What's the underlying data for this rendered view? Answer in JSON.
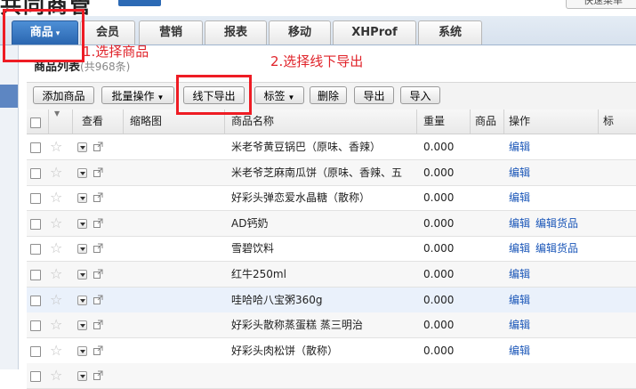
{
  "header": {
    "logo_text": "共同商管",
    "quick_menu": "快速菜单"
  },
  "nav": {
    "tabs": [
      {
        "label": "商品",
        "active": true
      },
      {
        "label": "会员"
      },
      {
        "label": "营销"
      },
      {
        "label": "报表"
      },
      {
        "label": "移动"
      },
      {
        "label": "XHProf"
      },
      {
        "label": "系统"
      }
    ],
    "active_caret": "▾"
  },
  "annotations": {
    "step1": "1.选择商品",
    "step2": "2.选择线下导出"
  },
  "page": {
    "title": "商品列表",
    "count": "(共968条)"
  },
  "toolbar": {
    "add": "添加商品",
    "batch": "批量操作",
    "offline_export": "线下导出",
    "tag": "标签",
    "delete": "删除",
    "export": "导出",
    "import": "导入"
  },
  "columns": {
    "view": "查看",
    "thumb": "缩略图",
    "name": "商品名称",
    "weight": "重量",
    "product": "商品",
    "ops": "操作",
    "tag_trunc": "标"
  },
  "rows": [
    {
      "name": "米老爷黄豆锅巴（原味、香辣）",
      "weight": "0.000",
      "ops": [
        "编辑"
      ]
    },
    {
      "name": "米老爷芝麻南瓜饼（原味、香辣、五",
      "weight": "0.000",
      "ops": [
        "编辑"
      ]
    },
    {
      "name": "好彩头弹恋爱水晶糖（散称）",
      "weight": "0.000",
      "ops": [
        "编辑"
      ]
    },
    {
      "name": "AD钙奶",
      "weight": "0.000",
      "ops": [
        "编辑",
        "编辑货品"
      ]
    },
    {
      "name": "雪碧饮料",
      "weight": "0.000",
      "ops": [
        "编辑",
        "编辑货品"
      ]
    },
    {
      "name": "红牛250ml",
      "weight": "0.000",
      "ops": [
        "编辑"
      ]
    },
    {
      "name": "哇哈哈八宝粥360g",
      "weight": "0.000",
      "ops": [
        "编辑"
      ]
    },
    {
      "name": "好彩头散称蒸蛋糕 蒸三明治",
      "weight": "0.000",
      "ops": [
        "编辑"
      ]
    },
    {
      "name": "好彩头肉松饼（散称）",
      "weight": "0.000",
      "ops": [
        "编辑"
      ]
    },
    {
      "name": "",
      "weight": "",
      "ops": []
    }
  ],
  "colors": {
    "nav_active": "#2a66b0",
    "annotation_red": "#ee1c24",
    "link_blue": "#1a56b8"
  }
}
